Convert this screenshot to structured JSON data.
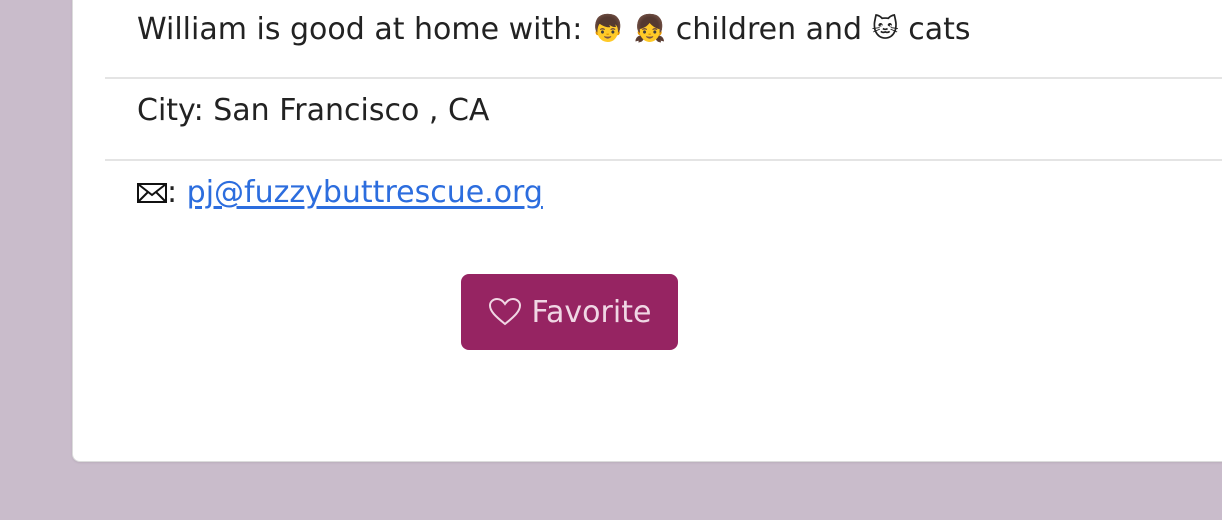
{
  "pet": {
    "good_with_prefix": "William is good at home with:",
    "emoji_boy": "👦",
    "emoji_girl": "👧",
    "children_label": "children and",
    "emoji_cat": "🐱",
    "cats_label": "cats",
    "city_line": "City: San Francisco , CA",
    "email_sep": ":",
    "email": "pj@fuzzybuttrescue.org",
    "favorite_label": "Favorite"
  },
  "colors": {
    "background": "#c9bccb",
    "button": "#962462",
    "link": "#2c6dde"
  },
  "icons": {
    "email": "envelope-icon",
    "favorite": "heart-outline-icon"
  }
}
